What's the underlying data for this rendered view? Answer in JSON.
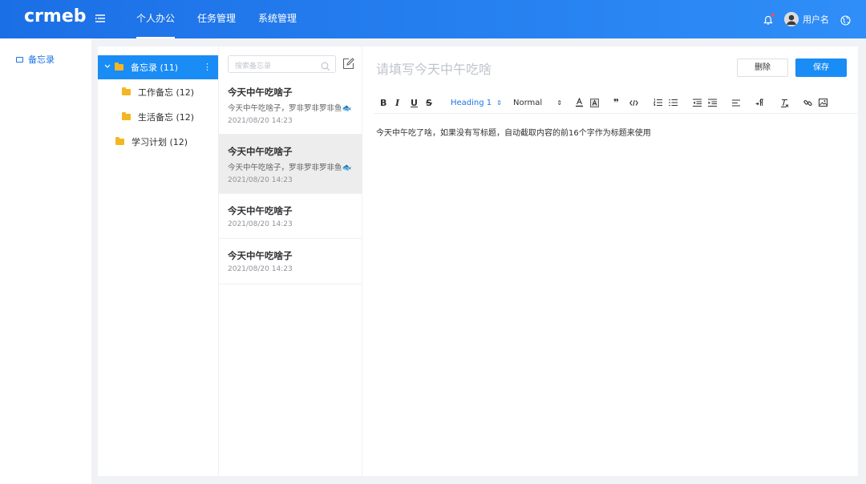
{
  "app": {
    "logo": "crmeb",
    "username": "用户名"
  },
  "nav": {
    "items": [
      "个人办公",
      "任务管理",
      "系统管理"
    ],
    "active_index": 0
  },
  "sidebar": {
    "items": [
      {
        "label": "备忘录",
        "active": true
      }
    ]
  },
  "tree": {
    "nodes": [
      {
        "label": "备忘录 (11)",
        "level": 0,
        "expanded": true,
        "active": true
      },
      {
        "label": "工作备忘 (12)",
        "level": 1
      },
      {
        "label": "生活备忘 (12)",
        "level": 1
      },
      {
        "label": "学习计划 (12)",
        "level": 0
      }
    ]
  },
  "note_list": {
    "search_placeholder": "搜索备忘录",
    "notes": [
      {
        "title": "今天中午吃啥子",
        "snippet": "今天中午吃啥子，罗非罗非罗非鱼🐟",
        "time": "2021/08/20 14:23"
      },
      {
        "title": "今天中午吃啥子",
        "snippet": "今天中午吃啥子，罗非罗非罗非鱼🐟",
        "time": "2021/08/20 14:23",
        "selected": true
      },
      {
        "title": "今天中午吃啥子",
        "time": "2021/08/20 14:23"
      },
      {
        "title": "今天中午吃啥子",
        "time": "2021/08/20 14:23"
      }
    ]
  },
  "editor": {
    "title_placeholder": "请填写今天中午吃啥",
    "delete_label": "删除",
    "save_label": "保存",
    "heading_select": "Heading 1",
    "size_select": "Normal",
    "content": "今天中午吃了啥，如果没有写标题，自动截取内容的前16个字作为标题来使用"
  },
  "colors": {
    "primary": "#1a8cf5",
    "topbar_start": "#1b6fe6",
    "topbar_end": "#2f8ef7",
    "folder": "#f5b623"
  }
}
